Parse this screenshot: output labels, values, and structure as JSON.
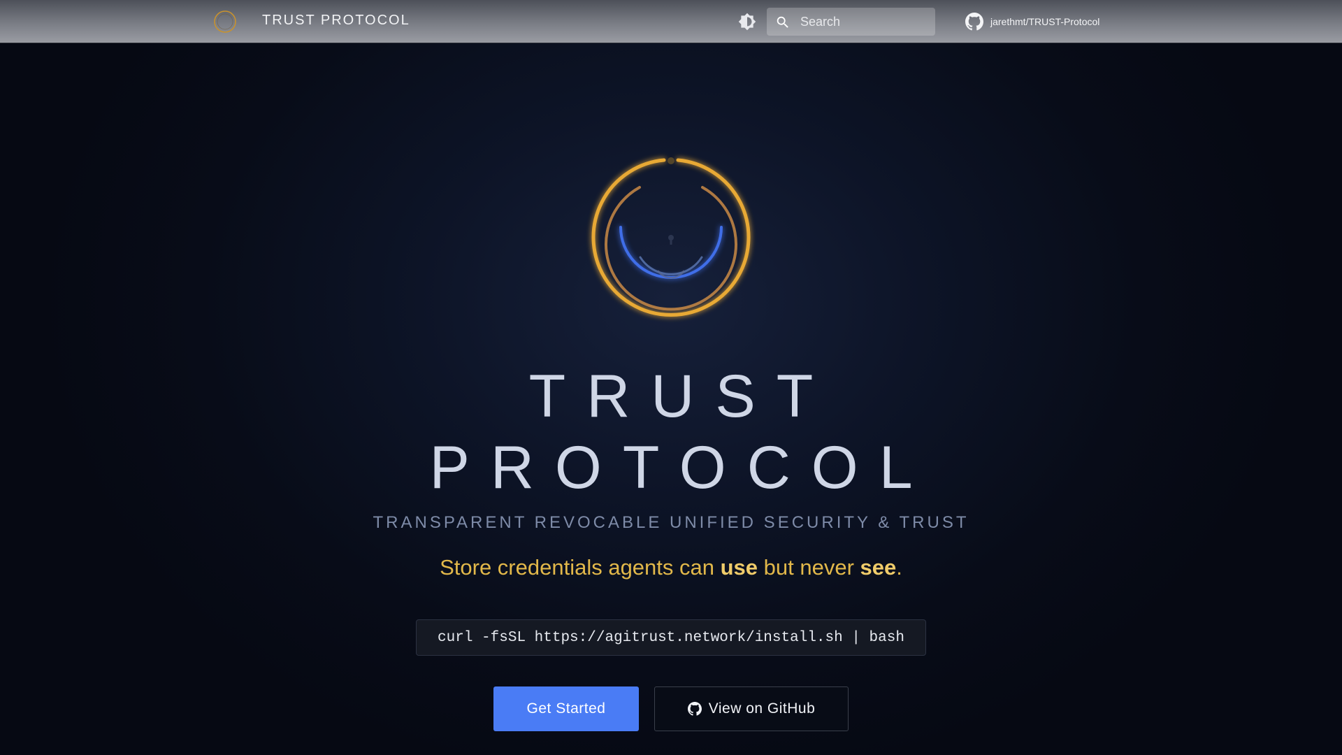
{
  "header": {
    "title": "TRUST PROTOCOL",
    "search_placeholder": "Search",
    "repo_label": "jarethmt/TRUST-Protocol"
  },
  "hero": {
    "title_line1": "TRUST",
    "title_line2": "PROTOCOL",
    "subtitle": "TRANSPARENT REVOCABLE UNIFIED SECURITY & TRUST",
    "tagline": {
      "part1": "Store credentials agents can ",
      "emph1": "use",
      "part2": " but never ",
      "emph2": "see",
      "part3": "."
    },
    "install_command": "curl -fsSL https://agitrust.network/install.sh | bash",
    "primary_button": "Get Started",
    "secondary_button": "View on GitHub"
  },
  "colors": {
    "accent_blue": "#4a7cf5",
    "gold": "#e2b84a",
    "title": "#cfd6e6"
  },
  "icons": {
    "logo": "trust-ring-logo-icon",
    "theme": "brightness-icon",
    "search": "search-icon",
    "github": "github-icon"
  }
}
